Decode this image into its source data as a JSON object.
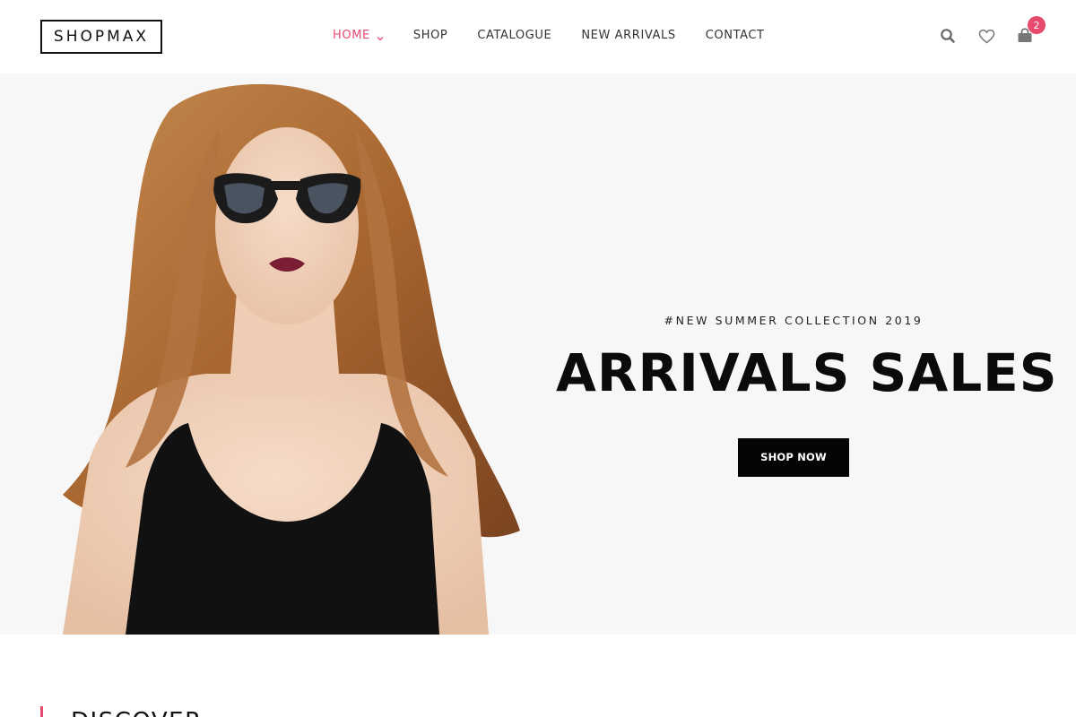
{
  "header": {
    "logo": "SHOPMAX",
    "nav": [
      {
        "label": "HOME",
        "active": true,
        "has_dropdown": true
      },
      {
        "label": "SHOP",
        "active": false
      },
      {
        "label": "CATALOGUE",
        "active": false
      },
      {
        "label": "NEW ARRIVALS",
        "active": false
      },
      {
        "label": "CONTACT",
        "active": false
      }
    ],
    "icons": [
      "search-icon",
      "heart-icon",
      "bag-icon"
    ],
    "cart_count": "2"
  },
  "hero": {
    "kicker": "#NEW SUMMER COLLECTION 2019",
    "title": "ARRIVALS SALES",
    "cta": "SHOP NOW"
  },
  "discover": {
    "title": "DISCOVER"
  },
  "colors": {
    "accent": "#e84a6f",
    "text": "#111111",
    "hero_bg": "#f7f7f7",
    "button_bg": "#050505"
  }
}
